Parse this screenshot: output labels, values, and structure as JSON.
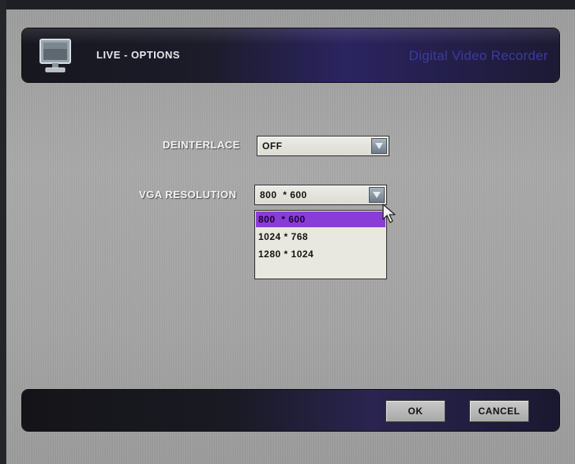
{
  "header": {
    "title": "LIVE - OPTIONS",
    "brand": "Digital Video Recorder",
    "icon": "monitor-icon"
  },
  "settings": {
    "deinterlace": {
      "label": "DEINTERLACE",
      "value": "OFF"
    },
    "vga_resolution": {
      "label": "VGA RESOLUTION",
      "value": "800  * 600",
      "options": [
        "800  * 600",
        "1024 * 768",
        "1280 * 1024"
      ],
      "selected_index": 0
    }
  },
  "footer": {
    "ok_label": "OK",
    "cancel_label": "CANCEL"
  },
  "colors": {
    "highlight": "#8a3dd6",
    "brand_text": "#3e3aa0"
  }
}
